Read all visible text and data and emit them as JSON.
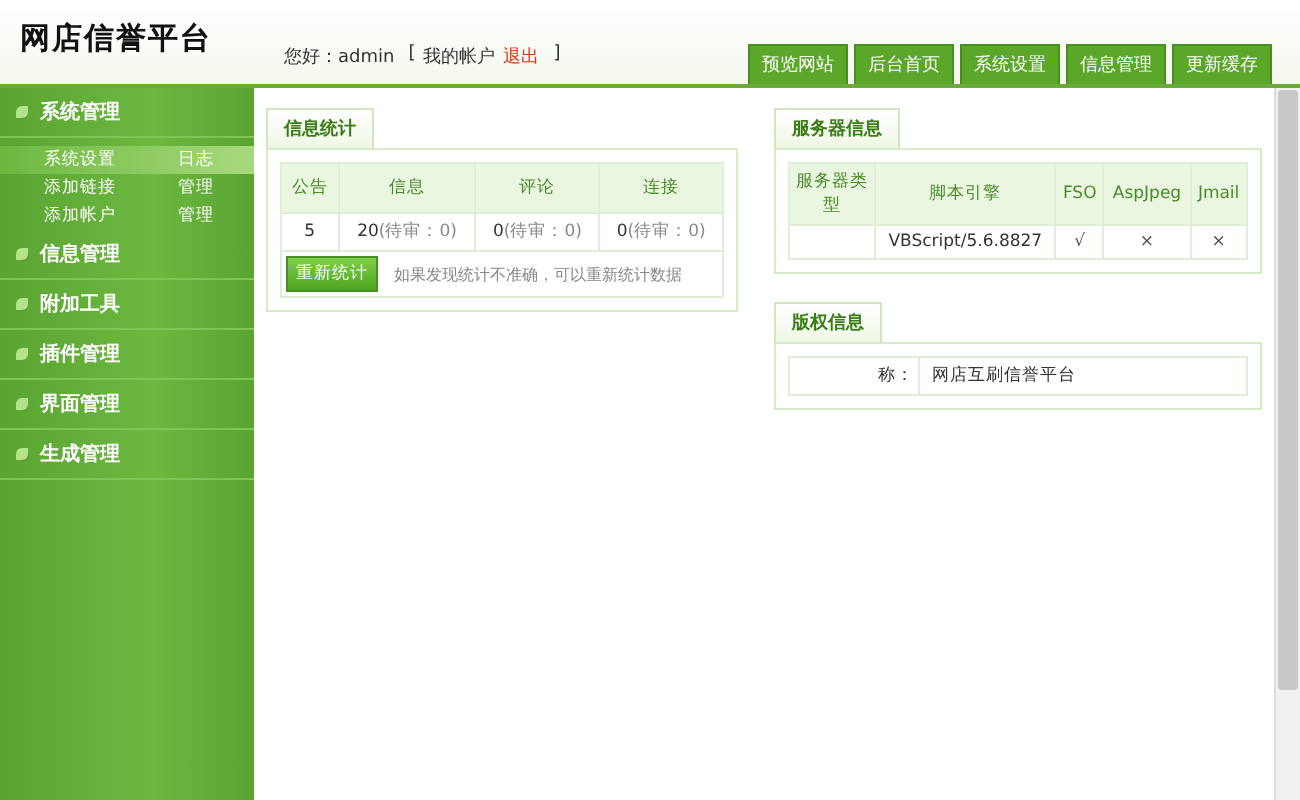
{
  "logo": "网店信誉平台",
  "user": {
    "greeting": "您好：admin",
    "account_link": "我的帐户",
    "logout_link": "退出",
    "open_bracket": "[",
    "close_bracket": "]"
  },
  "top_tabs": [
    "预览网站",
    "后台首页",
    "系统设置",
    "信息管理",
    "更新缓存"
  ],
  "sidebar": [
    {
      "label": "系统管理",
      "children": [
        {
          "label": "系统设置",
          "extra": "日志",
          "selected": true
        },
        {
          "label": "添加链接",
          "extra": "管理",
          "selected": false
        },
        {
          "label": "添加帐户",
          "extra": "管理",
          "selected": false
        }
      ]
    },
    {
      "label": "信息管理"
    },
    {
      "label": "附加工具"
    },
    {
      "label": "插件管理"
    },
    {
      "label": "界面管理"
    },
    {
      "label": "生成管理"
    }
  ],
  "stats": {
    "title": "信息统计",
    "columns": [
      "公告",
      "信息",
      "评论",
      "连接"
    ],
    "cells": [
      {
        "value": "5"
      },
      {
        "value": "20",
        "note": "(待审：0)"
      },
      {
        "value": "0",
        "note": "(待审：0)"
      },
      {
        "value": "0",
        "note": "(待审：0)"
      }
    ],
    "recount_button": "重新统计",
    "hint": "如果发现统计不准确，可以重新统计数据"
  },
  "server": {
    "title": "服务器信息",
    "columns": [
      "服务器类型",
      "脚本引擎",
      "FSO",
      "AspJpeg",
      "Jmail"
    ],
    "row": [
      "VBScript/5.6.8827",
      "√",
      "×",
      "×"
    ]
  },
  "copyright": {
    "title": "版权信息",
    "label": "称：",
    "value": "网店互刷信誉平台"
  }
}
